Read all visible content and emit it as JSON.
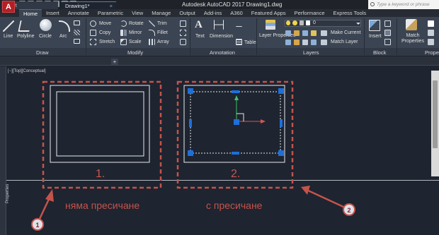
{
  "app": {
    "logo": "A",
    "title": "Autodesk AutoCAD 2017    Drawing1.dwg",
    "search_placeholder": "Type a keyword or phrase"
  },
  "ribbon_tabs": [
    "Home",
    "Insert",
    "Annotate",
    "Parametric",
    "View",
    "Manage",
    "Output",
    "Add-ins",
    "A360",
    "Featured Apps",
    "Performance",
    "Express Tools"
  ],
  "ribbon": {
    "draw": {
      "title": "Draw",
      "line": "Line",
      "polyline": "Polyline",
      "circle": "Circle",
      "arc": "Arc"
    },
    "modify": {
      "title": "Modify",
      "move": "Move",
      "rotate": "Rotate",
      "trim": "Trim",
      "copy": "Copy",
      "mirror": "Mirror",
      "fillet": "Fillet",
      "stretch": "Stretch",
      "scale": "Scale",
      "array": "Array"
    },
    "annotation": {
      "title": "Annotation",
      "text": "Text",
      "dimension": "Dimension",
      "table": "Table"
    },
    "layers": {
      "title": "Layers",
      "layer_properties": "Layer Properties",
      "current_layer": "0",
      "make_current": "Make Current",
      "match_layer": "Match Layer"
    },
    "block": {
      "title": "Block",
      "insert": "Insert"
    },
    "properties": {
      "title": "Prope",
      "match_properties": "Match Properties"
    }
  },
  "doc_tabs": {
    "start": "Start",
    "drawing": "Drawing1*",
    "close": "×",
    "new": "+"
  },
  "viewport_label": "[−][Top][Conceptual]",
  "properties_palette": "Properties",
  "annotations": {
    "num1": "1.",
    "num2": "2.",
    "label1": "няма пресичане",
    "label2": "с пресичане",
    "badge1": "1",
    "badge2": "2"
  },
  "colors": {
    "accent_red": "#c4534b",
    "grip_blue": "#1e6fd9",
    "canvas": "#1e2430"
  }
}
